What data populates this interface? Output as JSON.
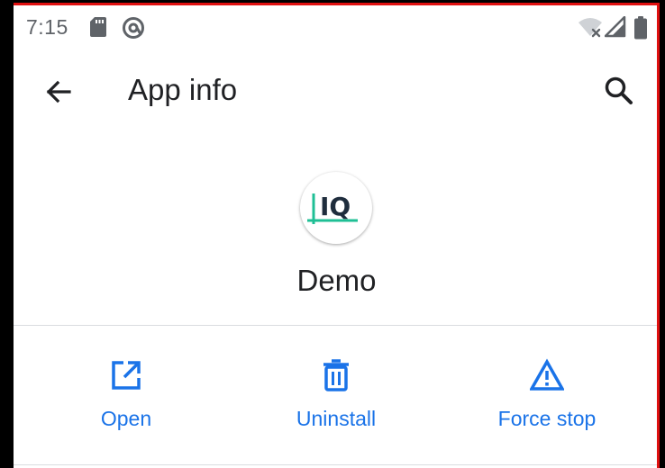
{
  "status_bar": {
    "time": "7:15",
    "icons": [
      "sd-card-icon",
      "at-sign-icon",
      "wifi-off-icon",
      "signal-icon",
      "battery-icon"
    ]
  },
  "app_bar": {
    "title": "App info",
    "back_icon": "arrow-back-icon",
    "search_icon": "search-icon"
  },
  "app": {
    "name": "Demo",
    "logo_text": "IQ"
  },
  "actions": [
    {
      "label": "Open",
      "icon": "open-in-new-icon"
    },
    {
      "label": "Uninstall",
      "icon": "trash-icon"
    },
    {
      "label": "Force stop",
      "icon": "warning-icon"
    }
  ],
  "colors": {
    "accent": "#1a73e8",
    "text_primary": "#202124",
    "text_secondary": "#5f6368",
    "divider": "#dadce0",
    "logo_teal": "#1fbf95",
    "logo_dark": "#1f2d3d"
  }
}
